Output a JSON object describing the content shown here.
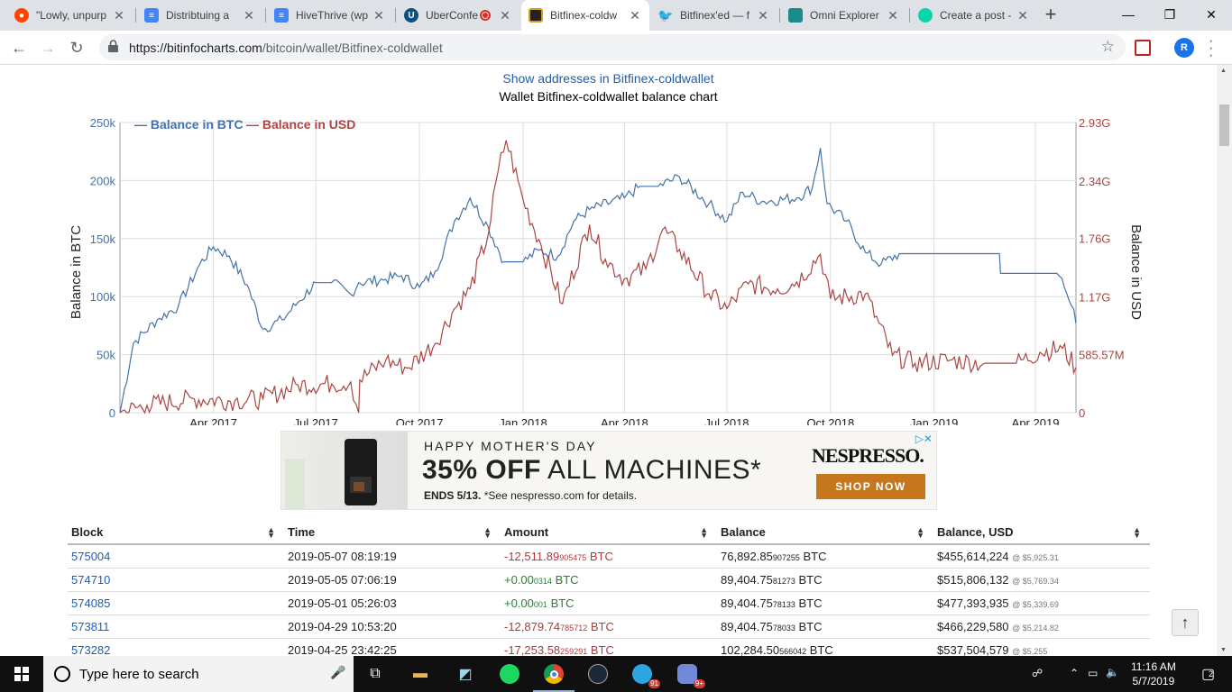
{
  "browser": {
    "tabs": [
      {
        "title": "\"Lowly, unpurp",
        "icon": "reddit-icon",
        "active": false
      },
      {
        "title": "Distribtuing a",
        "icon": "google-docs-icon",
        "active": false
      },
      {
        "title": "HiveThrive (wp",
        "icon": "google-docs-icon",
        "active": false
      },
      {
        "title": "UberConfe",
        "icon": "uberconference-icon",
        "active": false
      },
      {
        "title": "Bitfinex-coldw",
        "icon": "bitinfocharts-icon",
        "active": true
      },
      {
        "title": "Bitfinex'ed — f",
        "icon": "twitter-icon",
        "active": false
      },
      {
        "title": "Omni Explorer",
        "icon": "omni-explorer-icon",
        "active": false
      },
      {
        "title": "Create a post -",
        "icon": "steemit-icon",
        "active": false
      }
    ],
    "close_glyph": "✕",
    "new_tab_glyph": "+",
    "url_host": "https://bitinfocharts.com",
    "url_path": "/bitcoin/wallet/Bitfinex-coldwallet",
    "profile_initial": "R"
  },
  "page": {
    "show_addresses_link": "Show addresses in Bitfinex-coldwallet",
    "chart_title": "Wallet Bitfinex-coldwallet balance chart"
  },
  "chart_data": {
    "type": "line",
    "title": "Wallet Bitfinex-coldwallet balance chart",
    "ylabel": "Balance in BTC",
    "y2label": "Balance in USD",
    "legend_position": "top-left",
    "grid": true,
    "x_tick_labels": [
      "Apr 2017",
      "Jul 2017",
      "Oct 2017",
      "Jan 2018",
      "Apr 2018",
      "Jul 2018",
      "Oct 2018",
      "Jan 2019",
      "Apr 2019"
    ],
    "y_ticks": [
      0,
      50000,
      100000,
      150000,
      200000,
      250000
    ],
    "y_tick_labels": [
      "0",
      "50k",
      "100k",
      "150k",
      "200k",
      "250k"
    ],
    "y2_ticks": [
      0,
      585570000,
      1170000000,
      1760000000,
      2340000000,
      2930000000
    ],
    "y2_tick_labels": [
      "0",
      "585.57M",
      "1.17G",
      "1.76G",
      "2.34G",
      "2.93G"
    ],
    "ylim": [
      0,
      250000
    ],
    "y2lim": [
      0,
      2930000000
    ],
    "xlim": [
      "2017-01-08",
      "2019-05-07"
    ],
    "series": [
      {
        "name": "Balance in BTC",
        "color": "#4572a7",
        "axis": "left",
        "points": [
          [
            "2017-01-08",
            0
          ],
          [
            "2017-01-20",
            60000
          ],
          [
            "2017-02-10",
            80000
          ],
          [
            "2017-03-01",
            92000
          ],
          [
            "2017-03-20",
            128000
          ],
          [
            "2017-04-01",
            143000
          ],
          [
            "2017-04-15",
            135000
          ],
          [
            "2017-05-01",
            110000
          ],
          [
            "2017-05-15",
            72000
          ],
          [
            "2017-06-01",
            80000
          ],
          [
            "2017-06-15",
            95000
          ],
          [
            "2017-07-01",
            112000
          ],
          [
            "2017-07-15",
            112000
          ],
          [
            "2017-08-01",
            102000
          ],
          [
            "2017-08-08",
            112000
          ],
          [
            "2017-09-01",
            115000
          ],
          [
            "2017-09-15",
            118000
          ],
          [
            "2017-10-01",
            108000
          ],
          [
            "2017-10-15",
            122000
          ],
          [
            "2017-11-01",
            165000
          ],
          [
            "2017-11-15",
            185000
          ],
          [
            "2017-12-01",
            160000
          ],
          [
            "2017-12-15",
            130000
          ],
          [
            "2018-01-01",
            130000
          ],
          [
            "2018-01-15",
            140000
          ],
          [
            "2018-02-01",
            135000
          ],
          [
            "2018-02-15",
            165000
          ],
          [
            "2018-03-01",
            175000
          ],
          [
            "2018-04-01",
            185000
          ],
          [
            "2018-04-15",
            195000
          ],
          [
            "2018-05-01",
            195000
          ],
          [
            "2018-05-20",
            203000
          ],
          [
            "2018-06-15",
            180000
          ],
          [
            "2018-07-01",
            165000
          ],
          [
            "2018-07-15",
            190000
          ],
          [
            "2018-08-01",
            182000
          ],
          [
            "2018-09-01",
            185000
          ],
          [
            "2018-09-15",
            194000
          ],
          [
            "2018-09-22",
            228000
          ],
          [
            "2018-09-28",
            180000
          ],
          [
            "2018-10-15",
            165000
          ],
          [
            "2018-11-01",
            138000
          ],
          [
            "2018-11-15",
            128000
          ],
          [
            "2018-12-01",
            137000
          ],
          [
            "2018-12-31",
            137000
          ],
          [
            "2019-02-28",
            137000
          ],
          [
            "2019-03-01",
            120000
          ],
          [
            "2019-04-20",
            120000
          ],
          [
            "2019-04-29",
            102284
          ],
          [
            "2019-05-05",
            89404
          ],
          [
            "2019-05-07",
            76892
          ]
        ]
      },
      {
        "name": "Balance in USD",
        "color": "#aa4643",
        "axis": "right",
        "points": [
          [
            "2017-01-08",
            0
          ],
          [
            "2017-02-01",
            75000000
          ],
          [
            "2017-03-15",
            140000000
          ],
          [
            "2017-04-20",
            120000000
          ],
          [
            "2017-05-15",
            140000000
          ],
          [
            "2017-06-15",
            280000000
          ],
          [
            "2017-07-15",
            290000000
          ],
          [
            "2017-08-01",
            310000000
          ],
          [
            "2017-08-08",
            0
          ],
          [
            "2017-08-09",
            330000000
          ],
          [
            "2017-09-01",
            530000000
          ],
          [
            "2017-09-20",
            450000000
          ],
          [
            "2017-10-15",
            700000000
          ],
          [
            "2017-11-01",
            1050000000
          ],
          [
            "2017-11-15",
            1250000000
          ],
          [
            "2017-12-01",
            1800000000
          ],
          [
            "2017-12-10",
            2450000000
          ],
          [
            "2017-12-17",
            2750000000
          ],
          [
            "2018-01-01",
            2150000000
          ],
          [
            "2018-01-15",
            1750000000
          ],
          [
            "2018-02-05",
            1100000000
          ],
          [
            "2018-03-01",
            1900000000
          ],
          [
            "2018-03-15",
            1550000000
          ],
          [
            "2018-04-01",
            1350000000
          ],
          [
            "2018-04-20",
            1450000000
          ],
          [
            "2018-05-05",
            1850000000
          ],
          [
            "2018-05-20",
            1650000000
          ],
          [
            "2018-06-15",
            1200000000
          ],
          [
            "2018-07-01",
            1050000000
          ],
          [
            "2018-07-20",
            1300000000
          ],
          [
            "2018-08-15",
            1250000000
          ],
          [
            "2018-09-01",
            1320000000
          ],
          [
            "2018-09-22",
            1600000000
          ],
          [
            "2018-10-01",
            1150000000
          ],
          [
            "2018-11-01",
            1200000000
          ],
          [
            "2018-11-25",
            580000000
          ],
          [
            "2018-12-15",
            500000000
          ],
          [
            "2019-01-15",
            530000000
          ],
          [
            "2019-02-15",
            500000000
          ],
          [
            "2019-03-15",
            500000000
          ],
          [
            "2019-04-05",
            610000000
          ],
          [
            "2019-04-25",
            650000000
          ],
          [
            "2019-05-07",
            455614224
          ]
        ]
      }
    ]
  },
  "table": {
    "headers": [
      "Block",
      "Time",
      "Amount",
      "Balance",
      "Balance, USD"
    ],
    "rows": [
      {
        "block": "575004",
        "time": "2019-05-07 08:19:19",
        "amount_main": "-12,511.89",
        "amount_frac": "905475",
        "amount_unit": "BTC",
        "amount_sign": "neg",
        "bal_main": "76,892.85",
        "bal_frac": "907255",
        "bal_unit": "BTC",
        "usd": "$455,614,224",
        "rate": "@ $5,925.31"
      },
      {
        "block": "574710",
        "time": "2019-05-05 07:06:19",
        "amount_main": "+0.00",
        "amount_frac": "0314",
        "amount_unit": "BTC",
        "amount_sign": "pos",
        "bal_main": "89,404.75",
        "bal_frac": "81273",
        "bal_unit": "BTC",
        "usd": "$515,806,132",
        "rate": "@ $5,769.34"
      },
      {
        "block": "574085",
        "time": "2019-05-01 05:26:03",
        "amount_main": "+0.00",
        "amount_frac": "001",
        "amount_unit": "BTC",
        "amount_sign": "pos",
        "bal_main": "89,404.75",
        "bal_frac": "78133",
        "bal_unit": "BTC",
        "usd": "$477,393,935",
        "rate": "@ $5,339.69"
      },
      {
        "block": "573811",
        "time": "2019-04-29 10:53:20",
        "amount_main": "-12,879.74",
        "amount_frac": "785712",
        "amount_unit": "BTC",
        "amount_sign": "neg",
        "bal_main": "89,404.75",
        "bal_frac": "78033",
        "bal_unit": "BTC",
        "usd": "$466,229,580",
        "rate": "@ $5,214.82"
      },
      {
        "block": "573282",
        "time": "2019-04-25 23:42:25",
        "amount_main": "-17,253.58",
        "amount_frac": "259291",
        "amount_unit": "BTC",
        "amount_sign": "neg",
        "bal_main": "102,284.50",
        "bal_frac": "566042",
        "bal_unit": "BTC",
        "usd": "$537,504,579",
        "rate": "@ $5,255"
      }
    ]
  },
  "ad": {
    "headline": "HAPPY MOTHER'S DAY",
    "offer_bold": "35% OFF",
    "offer_rest": " ALL MACHINES*",
    "ends_bold": "ENDS 5/13.",
    "ends_rest": " *See nespresso.com for details.",
    "brand": "NESPRESSO.",
    "cta": "SHOP NOW",
    "choices_glyph": "▷✕"
  },
  "scroll_top_glyph": "↑",
  "taskbar": {
    "search_placeholder": "Type here to search",
    "clock_time": "11:16 AM",
    "clock_date": "5/7/2019",
    "telegram_badge": "91",
    "discord_badge": "9+",
    "notification_count": "2"
  }
}
